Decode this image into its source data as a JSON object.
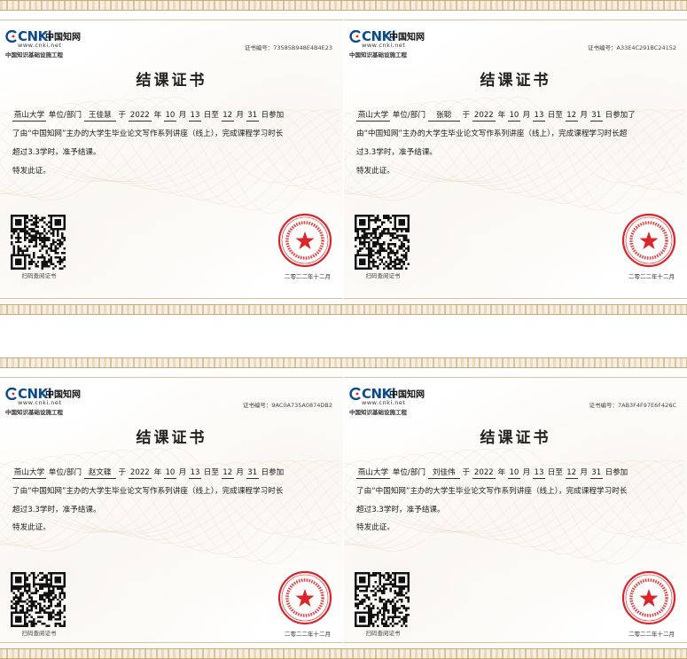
{
  "logo": {
    "mark": "CNKi",
    "cn_name": "中国知网",
    "url": "www.cnki.net",
    "subtitle": "中国知识基础设施工程"
  },
  "certificates": [
    {
      "cert_no": "证书编号：73585B948E4B4E23",
      "title": "结课证书",
      "school": "燕山大学",
      "unit_label": "单位/部门",
      "name": "王佳慧",
      "yu": "于",
      "start_year": "2022",
      "start_month": "10",
      "start_day": "13",
      "end_month": "12",
      "end_day": "31",
      "nian": "年",
      "yue": "月",
      "ri_zhi": "日至",
      "yue2": "月",
      "tail": "日参加",
      "line2": "了由“中国知网”主办的大学生毕业论文写作系列讲座（线上），完成课程学习时长",
      "line3": "超过3.3学时，准予结课。",
      "closing": "特发此证。",
      "qr_label": "扫码查阅证书",
      "date": "二零二二年十二月"
    },
    {
      "cert_no": "证书编号：A33E4C291BC24152",
      "title": "结课证书",
      "school": "燕山大学",
      "unit_label": "单位/部门",
      "name": "张聪",
      "yu": "于",
      "start_year": "2022",
      "start_month": "10",
      "start_day": "13",
      "end_month": "12",
      "end_day": "31",
      "nian": "年",
      "yue": "月",
      "ri_zhi": "日至",
      "yue2": "月",
      "tail": "日参加了",
      "line2": "由“中国知网”主办的大学生毕业论文写作系列讲座（线上），完成课程学习时长超",
      "line3": "过3.3学时，准予结课。",
      "closing": "特发此证。",
      "qr_label": "扫码查阅证书",
      "date": "二零二二年十二月"
    },
    {
      "cert_no": "证书编号：9AC0A735A0874DB2",
      "title": "结课证书",
      "school": "燕山大学",
      "unit_label": "单位/部门",
      "name": "赵文碟",
      "yu": "于",
      "start_year": "2022",
      "start_month": "10",
      "start_day": "13",
      "end_month": "12",
      "end_day": "31",
      "nian": "年",
      "yue": "月",
      "ri_zhi": "日至",
      "yue2": "月",
      "tail": "日参加",
      "line2": "了由“中国知网”主办的大学生毕业论文写作系列讲座（线上），完成课程学习时长",
      "line3": "超过3.3学时，准予结课。",
      "closing": "特发此证。",
      "qr_label": "扫码查阅证书",
      "date": "二零二二年十二月"
    },
    {
      "cert_no": "证书编号：7AB3F4F97E6F426C",
      "title": "结课证书",
      "school": "燕山大学",
      "unit_label": "单位/部门",
      "name": "刘佳伟",
      "yu": "于",
      "start_year": "2022",
      "start_month": "10",
      "start_day": "13",
      "end_month": "12",
      "end_day": "31",
      "nian": "年",
      "yue": "月",
      "ri_zhi": "日至",
      "yue2": "月",
      "tail": "日参加",
      "line2": "了由“中国知网”主办的大学生毕业论文写作系列讲座（线上），完成课程学习时长",
      "line3": "超过3.3学时，准予结课。",
      "closing": "特发此证。",
      "qr_label": "扫码查阅证书",
      "date": "二零二二年十二月"
    }
  ],
  "colors": {
    "cnki_blue": "#0b4a8b",
    "seal_red": "#d9252b",
    "border_gold": "#c9ab7a"
  },
  "icons": {
    "seal": "red-star-seal-icon",
    "qr": "qr-code-icon"
  }
}
